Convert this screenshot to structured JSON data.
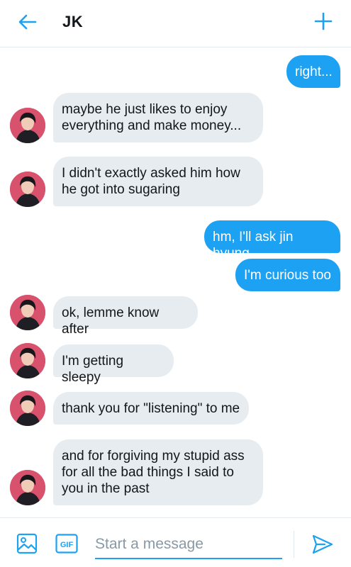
{
  "header": {
    "title": "JK",
    "back_icon": "arrow-left-icon",
    "new_icon": "plus-icon"
  },
  "colors": {
    "accent": "#1da1f2",
    "incoming_bubble": "#e6ecf0",
    "text": "#14171a",
    "avatar_bg": "#d8526e"
  },
  "messages": [
    {
      "direction": "out",
      "text": "right..."
    },
    {
      "direction": "in",
      "text": "maybe he just likes to enjoy everything and make money..."
    },
    {
      "direction": "in",
      "text": "I didn't exactly asked him how he got into sugaring"
    },
    {
      "direction": "out",
      "text": "hm, I'll ask jin hyung"
    },
    {
      "direction": "out",
      "text": "I'm curious too"
    },
    {
      "direction": "in",
      "text": "ok, lemme know after"
    },
    {
      "direction": "in",
      "text": "I'm getting sleepy"
    },
    {
      "direction": "in",
      "text": "thank you for \"listening\" to me"
    },
    {
      "direction": "in",
      "text": "and for forgiving my stupid ass for all the bad things I said to you in the past"
    }
  ],
  "composer": {
    "placeholder": "Start a message",
    "value": "",
    "media_icon": "image-icon",
    "gif_label": "GIF",
    "send_icon": "send-icon"
  }
}
